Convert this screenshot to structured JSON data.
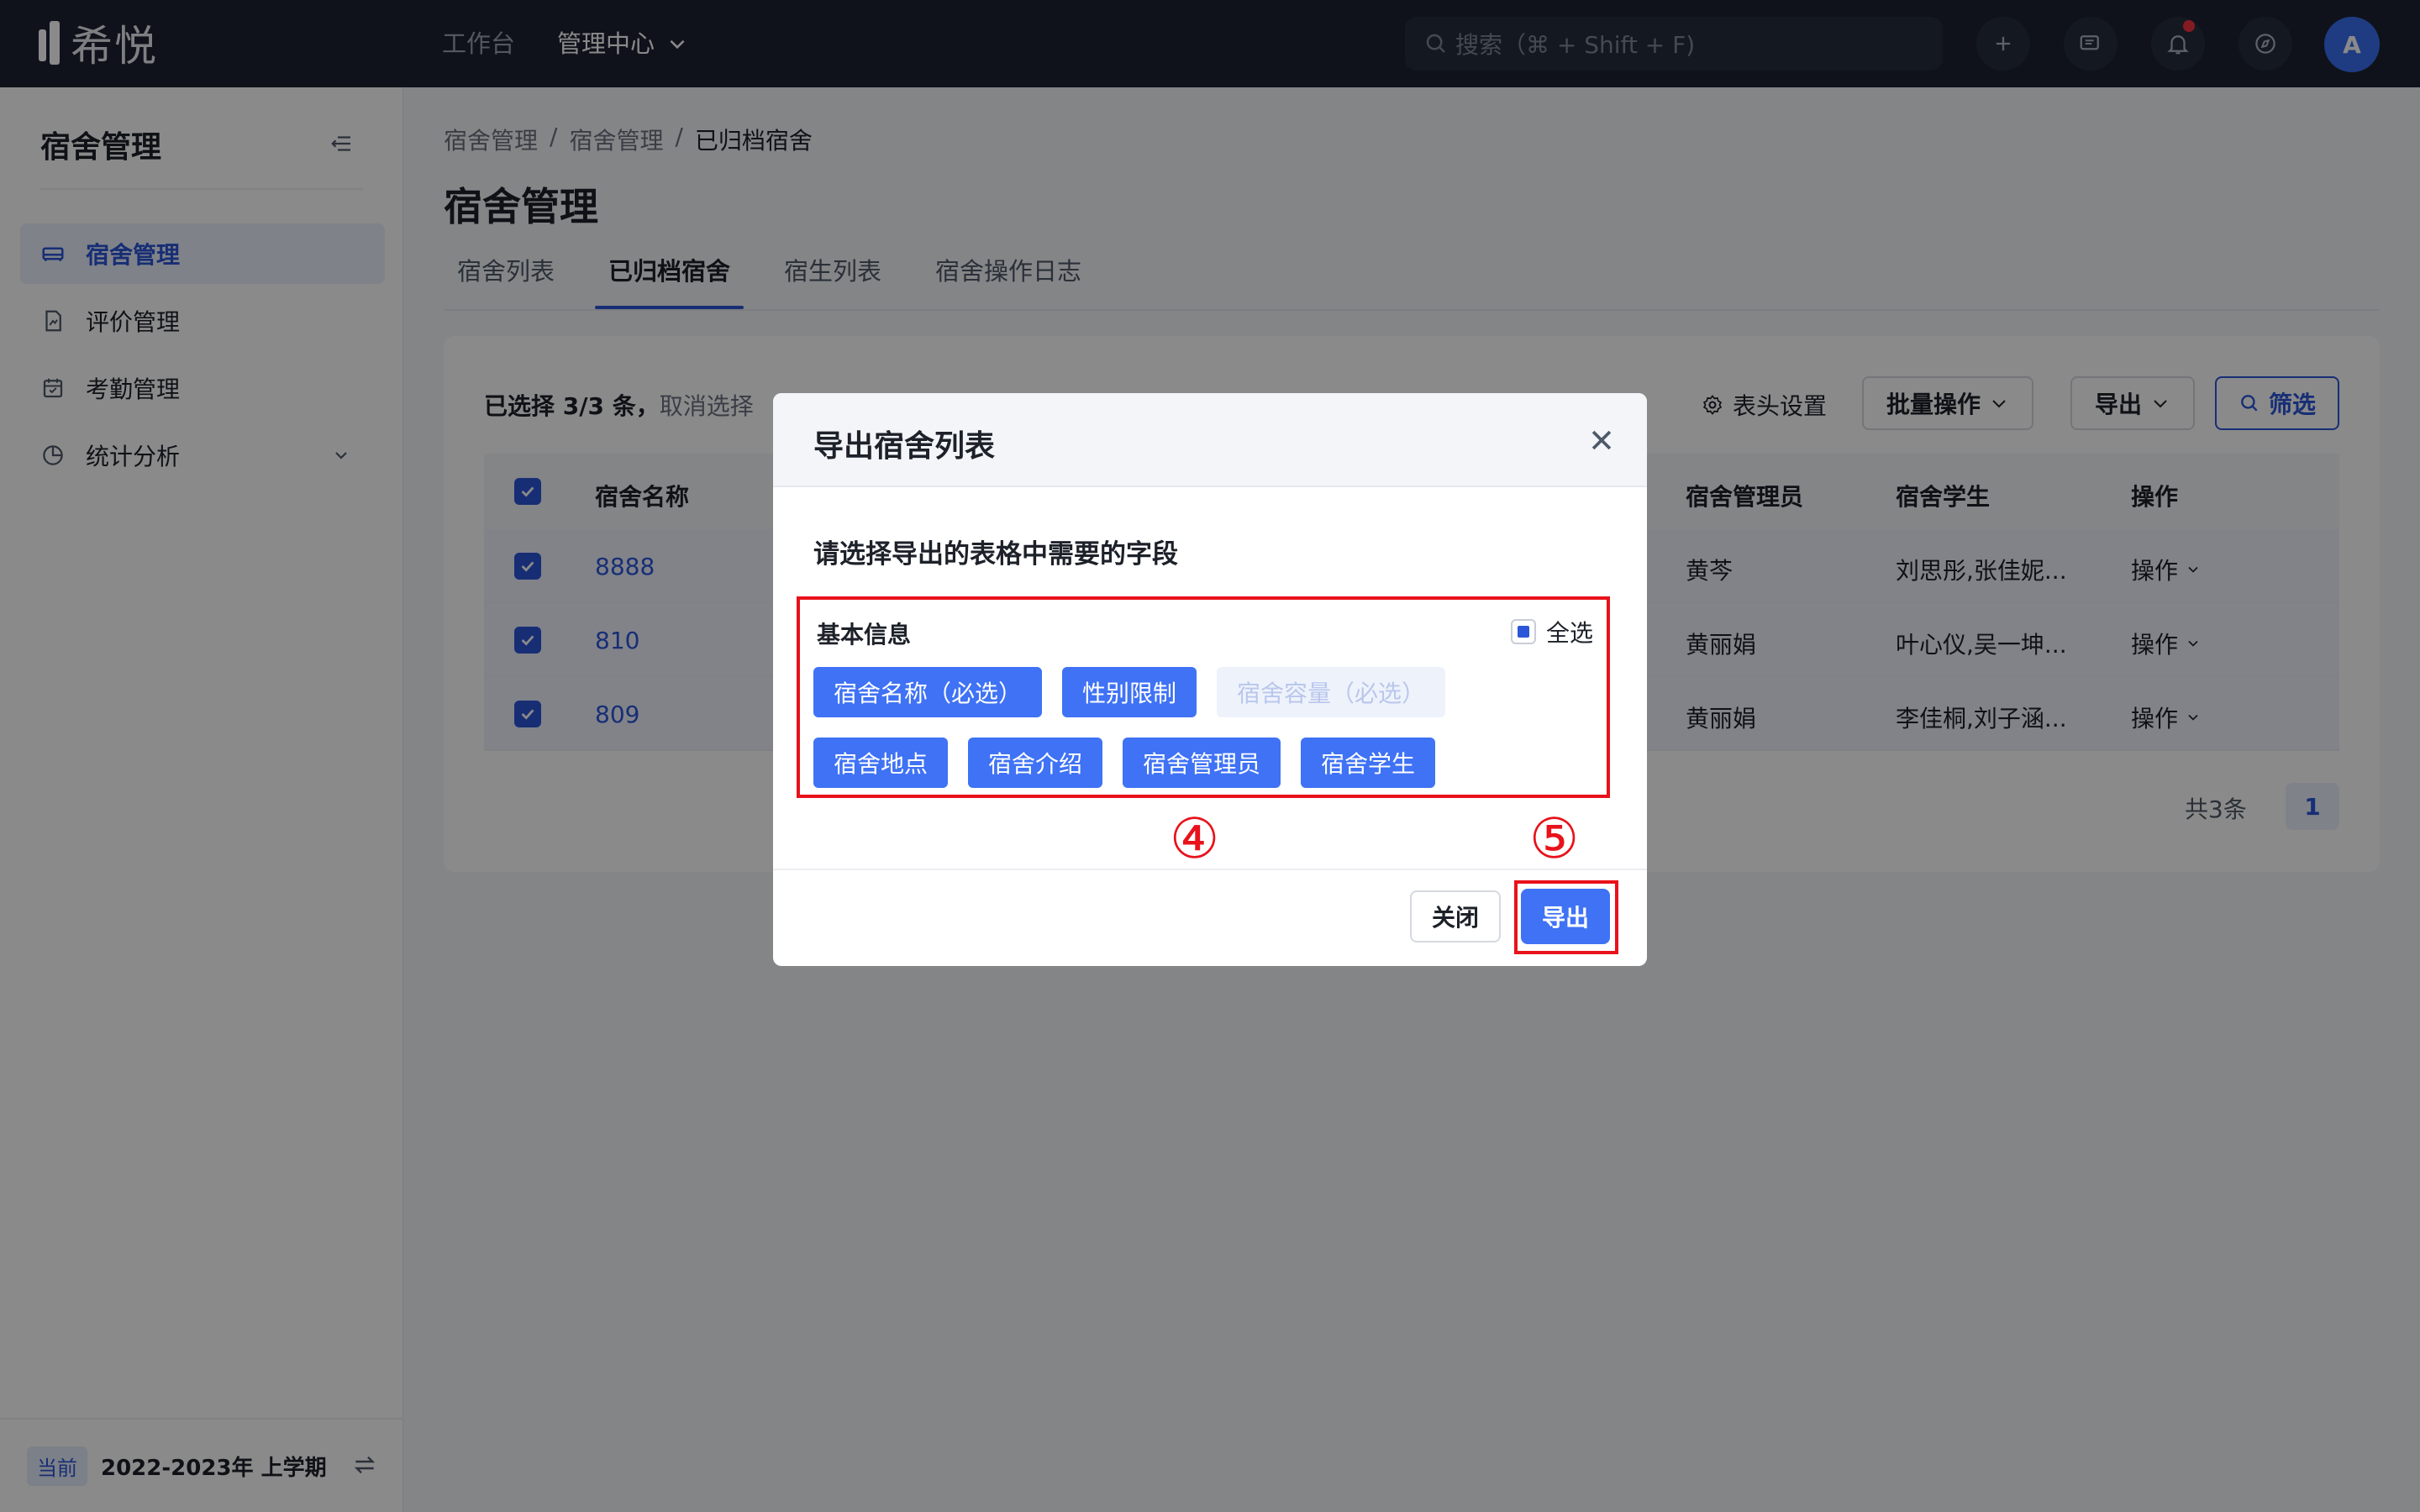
{
  "app": {
    "logo_text": "希悦"
  },
  "topnav": {
    "items": [
      {
        "label": "工作台"
      },
      {
        "label": "管理中心"
      }
    ]
  },
  "search": {
    "placeholder": "搜索（⌘ + Shift + F)"
  },
  "avatar": {
    "initial": "A"
  },
  "sidebar": {
    "title": "宿舍管理",
    "items": [
      {
        "label": "宿舍管理",
        "icon": "bed-icon"
      },
      {
        "label": "评价管理",
        "icon": "evaluation-icon"
      },
      {
        "label": "考勤管理",
        "icon": "calendar-icon"
      },
      {
        "label": "统计分析",
        "icon": "pie-chart-icon"
      }
    ],
    "term_tag": "当前",
    "term_text": "2022-2023年 上学期"
  },
  "breadcrumb": [
    "宿舍管理",
    "宿舍管理",
    "已归档宿舍"
  ],
  "breadcrumb_sep": "/",
  "page_title": "宿舍管理",
  "tabs": [
    "宿舍列表",
    "已归档宿舍",
    "宿生列表",
    "宿舍操作日志"
  ],
  "toolbar": {
    "selected_text": "已选择 3/3 条，",
    "cancel_select": "取消选择",
    "header_settings": "表头设置",
    "batch": "批量操作",
    "export": "导出",
    "filter": "筛选"
  },
  "table": {
    "columns": {
      "name": "宿舍名称",
      "manager": "宿舍管理员",
      "students": "宿舍学生",
      "action": "操作"
    },
    "rows": [
      {
        "name": "8888",
        "manager": "黄芩",
        "students": "刘思彤,张佳妮...",
        "action": "操作"
      },
      {
        "name": "810",
        "manager": "黄丽娟",
        "students": "叶心仪,吴一坤...",
        "action": "操作"
      },
      {
        "name": "809",
        "manager": "黄丽娟",
        "students": "李佳桐,刘子涵...",
        "action": "操作"
      }
    ]
  },
  "pager": {
    "total": "共3条",
    "page": "1"
  },
  "modal": {
    "title": "导出宿舍列表",
    "subtitle": "请选择导出的表格中需要的字段",
    "group_title": "基本信息",
    "select_all": "全选",
    "fields": [
      {
        "label": "宿舍名称（必选）",
        "state": "selected"
      },
      {
        "label": "性别限制",
        "state": "selected"
      },
      {
        "label": "宿舍容量（必选）",
        "state": "disabled"
      },
      {
        "label": "宿舍地点",
        "state": "selected"
      },
      {
        "label": "宿舍介绍",
        "state": "selected"
      },
      {
        "label": "宿舍管理员",
        "state": "selected"
      },
      {
        "label": "宿舍学生",
        "state": "selected"
      }
    ],
    "close_label": "关闭",
    "export_label": "导出"
  },
  "annotations": {
    "step4": "④",
    "step5": "⑤"
  },
  "colors": {
    "primary": "#3f72f5",
    "accent_red": "#e8121b",
    "topbar": "#1c2232"
  }
}
